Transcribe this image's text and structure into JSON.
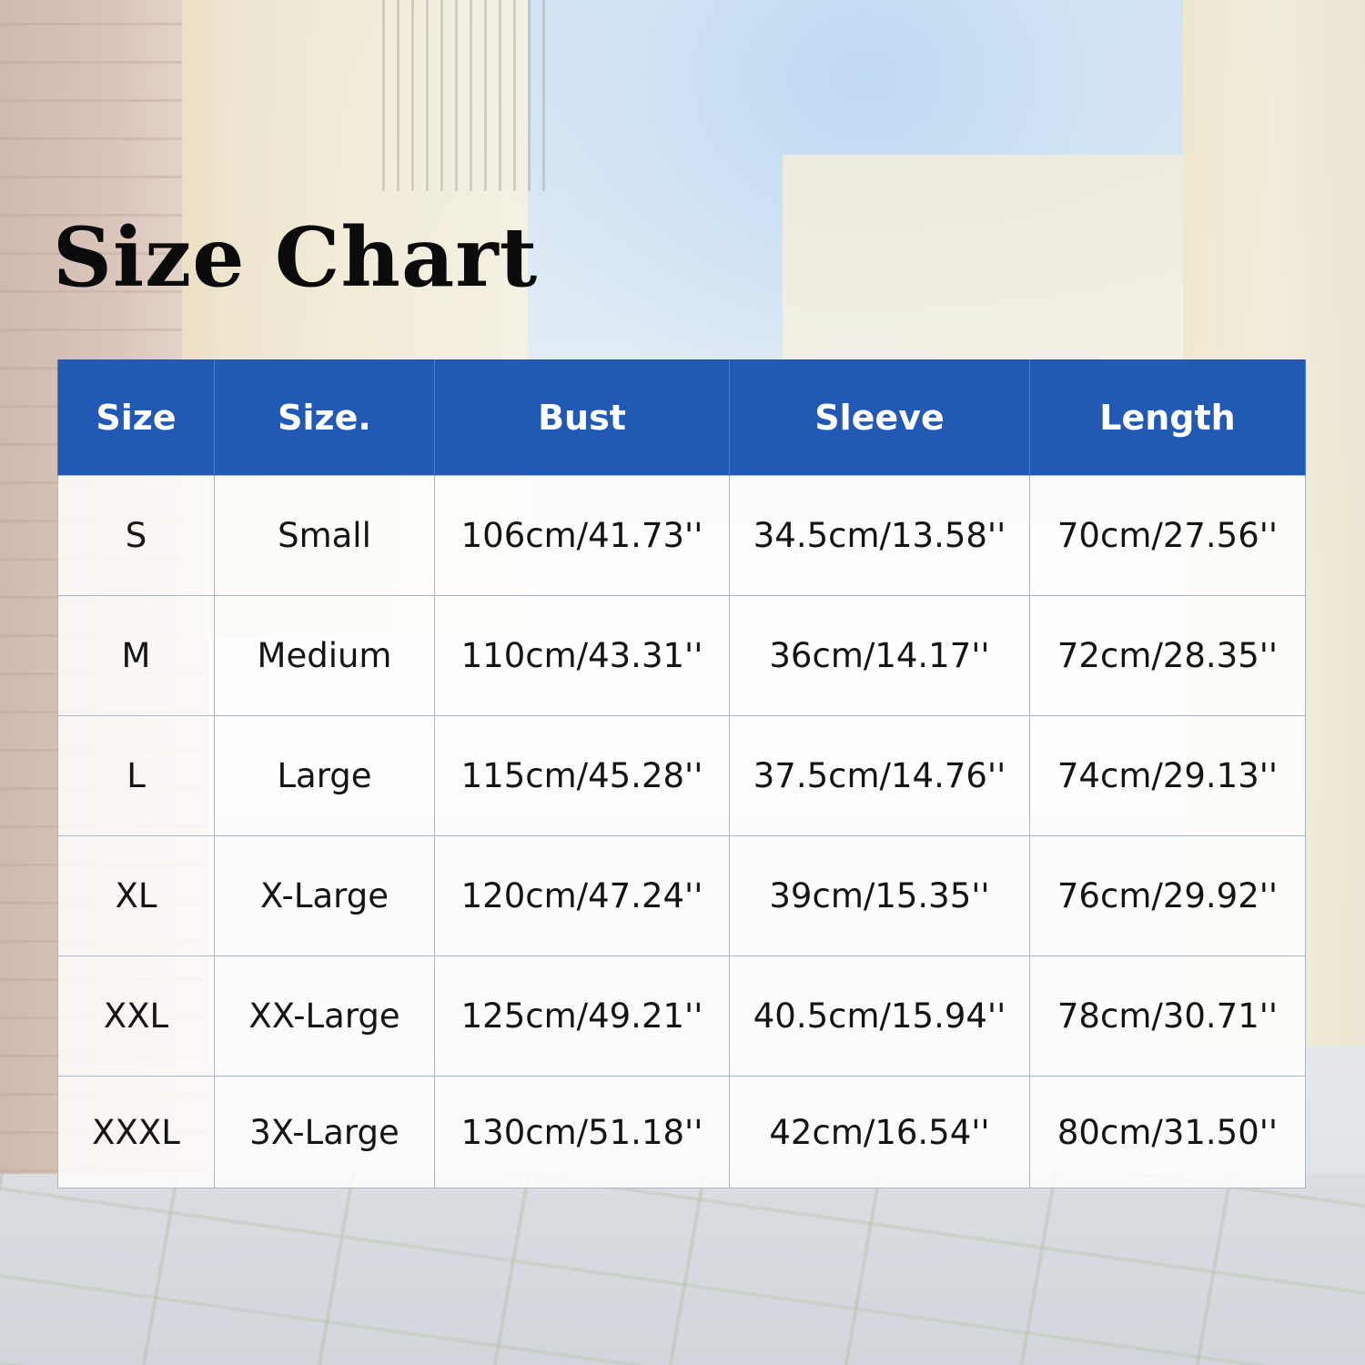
{
  "title": "Size Chart",
  "colors": {
    "header_bg": "#2159b4",
    "header_text": "#ffffff",
    "cell_bg": "#ffffff",
    "title_text": "#0b0b0b"
  },
  "table": {
    "headers": [
      "Size",
      "Size.",
      "Bust",
      "Sleeve",
      "Length"
    ],
    "rows": [
      [
        "S",
        "Small",
        "106cm/41.73''",
        "34.5cm/13.58''",
        "70cm/27.56''"
      ],
      [
        "M",
        "Medium",
        "110cm/43.31''",
        "36cm/14.17''",
        "72cm/28.35''"
      ],
      [
        "L",
        "Large",
        "115cm/45.28''",
        "37.5cm/14.76''",
        "74cm/29.13''"
      ],
      [
        "XL",
        "X-Large",
        "120cm/47.24''",
        "39cm/15.35''",
        "76cm/29.92''"
      ],
      [
        "XXL",
        "XX-Large",
        "125cm/49.21''",
        "40.5cm/15.94''",
        "78cm/30.71''"
      ],
      [
        "XXXL",
        "3X-Large",
        "130cm/51.18''",
        "42cm/16.54''",
        "80cm/31.50''"
      ]
    ]
  }
}
